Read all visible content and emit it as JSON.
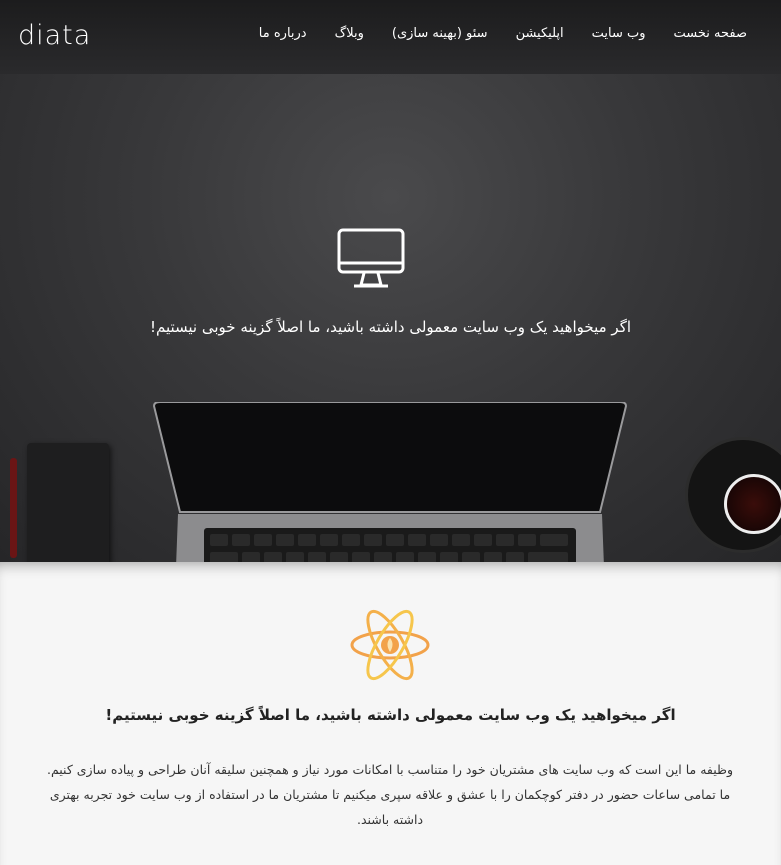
{
  "brand": {
    "logo_text": "diata"
  },
  "nav": {
    "items": [
      {
        "label": "صفحه نخست"
      },
      {
        "label": "وب سایت"
      },
      {
        "label": "اپلیکیشن"
      },
      {
        "label": "سئو (بهینه سازی)"
      },
      {
        "label": "وبلاگ"
      },
      {
        "label": "درباره ما"
      }
    ]
  },
  "hero": {
    "icon": "desktop-monitor-icon",
    "text": "اگر میخواهید یک وب سایت معمولی داشته باشید، ما اصلاً گزینه خوبی نیستیم!"
  },
  "content": {
    "icon": "atom-icon",
    "title": "اگر میخواهید یک وب سایت معمولی داشته باشید، ما اصلاً گزینه خوبی نیستیم!",
    "body": "وظیفه ما این است که وب سایت های مشتریان خود را متناسب با امکانات مورد نیاز و همچنین سلیقه آنان طراحی و پیاده سازی کنیم. ما تمامی ساعات حضور در دفتر کوچکمان را با عشق و علاقه سپری میکنیم تا مشتریان ما در استفاده از وب سایت خود تجربه بهتری داشته باشند."
  },
  "colors": {
    "hero_bg": "#38383a",
    "content_bg": "#f6f6f6",
    "atom_orange": "#f2a24a",
    "atom_yellow": "#f6c64c"
  }
}
